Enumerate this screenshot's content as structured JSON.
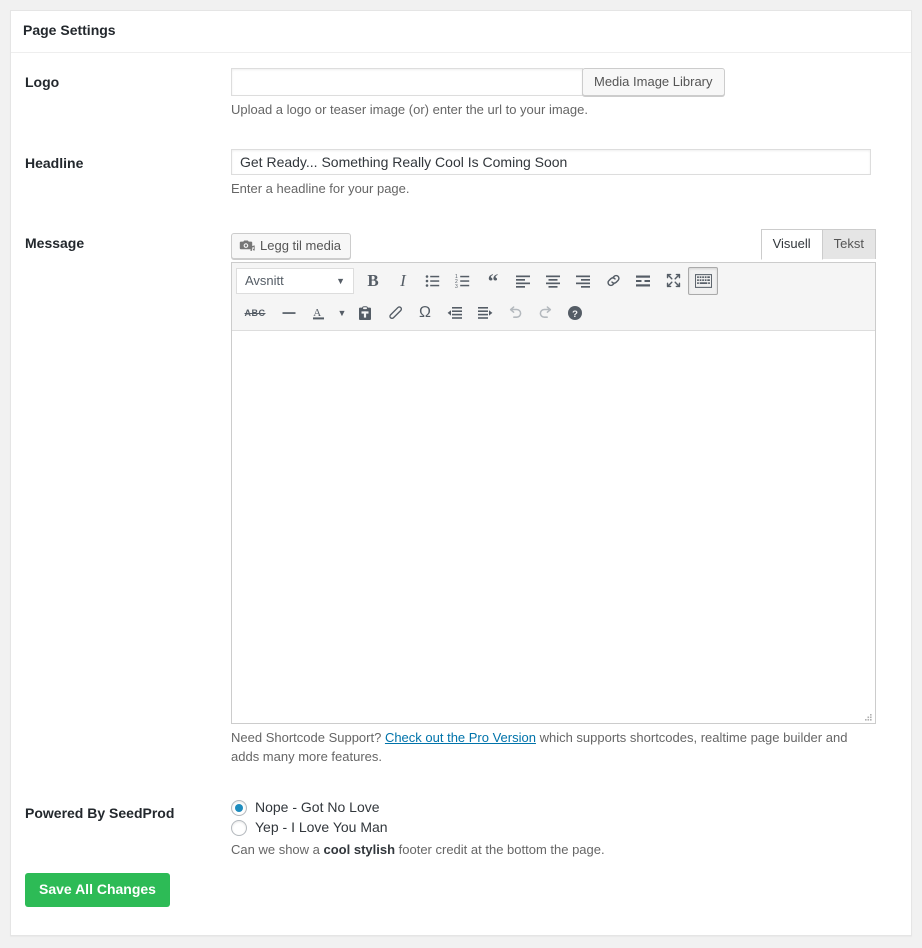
{
  "panel": {
    "title": "Page Settings"
  },
  "fields": {
    "logo": {
      "label": "Logo",
      "value": "",
      "placeholder": "",
      "button_label": "Media Image Library",
      "description": "Upload a logo or teaser image (or) enter the url to your image."
    },
    "headline": {
      "label": "Headline",
      "value": "Get Ready... Something Really Cool Is Coming Soon",
      "placeholder": "",
      "description": "Enter a headline for your page."
    },
    "message": {
      "label": "Message",
      "media_button_label": "Legg til media",
      "media_button_icon": "add-media-icon",
      "tabs": [
        {
          "label": "Visuell",
          "active": true
        },
        {
          "label": "Tekst",
          "active": false
        }
      ],
      "format_select": "Avsnitt",
      "toolbar_row_1": [
        {
          "name": "bold-icon",
          "glyph": "B",
          "style": "bold-serif",
          "active": false
        },
        {
          "name": "italic-icon",
          "glyph": "I",
          "style": "italic-serif",
          "active": false
        },
        {
          "name": "bulleted-list-icon",
          "glyph": "",
          "style": "svg-ul",
          "active": false
        },
        {
          "name": "numbered-list-icon",
          "glyph": "",
          "style": "svg-ol",
          "active": false
        },
        {
          "name": "blockquote-icon",
          "glyph": "“",
          "style": "quote",
          "active": false
        },
        {
          "name": "align-left-icon",
          "glyph": "",
          "style": "svg-alignleft",
          "active": false
        },
        {
          "name": "align-center-icon",
          "glyph": "",
          "style": "svg-aligncenter",
          "active": false
        },
        {
          "name": "align-right-icon",
          "glyph": "",
          "style": "svg-alignright",
          "active": false
        },
        {
          "name": "insert-link-icon",
          "glyph": "",
          "style": "svg-link",
          "active": false
        },
        {
          "name": "read-more-icon",
          "glyph": "",
          "style": "svg-more",
          "active": false
        },
        {
          "name": "fullscreen-icon",
          "glyph": "",
          "style": "svg-fullscreen",
          "active": false
        },
        {
          "name": "kitchen-sink-icon",
          "glyph": "",
          "style": "svg-sink",
          "active": true
        }
      ],
      "toolbar_row_2": [
        {
          "name": "strikethrough-icon",
          "glyph": "ABC",
          "style": "abc",
          "active": false
        },
        {
          "name": "horizontal-rule-icon",
          "glyph": "",
          "style": "svg-hr",
          "active": false
        },
        {
          "name": "text-color-icon",
          "glyph": "A",
          "style": "svg-textcolor",
          "active": false
        },
        {
          "name": "text-color-dropdown-icon",
          "glyph": "▼",
          "style": "caret-only",
          "active": false
        },
        {
          "name": "paste-as-text-icon",
          "glyph": "",
          "style": "svg-paste",
          "active": false
        },
        {
          "name": "clear-formatting-icon",
          "glyph": "",
          "style": "svg-eraser",
          "active": false
        },
        {
          "name": "special-character-icon",
          "glyph": "Ω",
          "style": "omega",
          "active": false
        },
        {
          "name": "decrease-indent-icon",
          "glyph": "",
          "style": "svg-outdent",
          "active": false
        },
        {
          "name": "increase-indent-icon",
          "glyph": "",
          "style": "svg-indent",
          "active": false
        },
        {
          "name": "undo-icon",
          "glyph": "",
          "style": "svg-undo",
          "active": false,
          "disabled": true
        },
        {
          "name": "redo-icon",
          "glyph": "",
          "style": "svg-redo",
          "active": false,
          "disabled": true
        },
        {
          "name": "help-icon",
          "glyph": "",
          "style": "svg-help",
          "active": false
        }
      ],
      "body_value": "",
      "shortcode_note_prefix": "Need Shortcode Support? ",
      "shortcode_link_text": "Check out the Pro Version",
      "shortcode_note_suffix": " which supports shortcodes, realtime page builder and adds many more features."
    },
    "powered_by": {
      "label": "Powered By SeedProd",
      "options": [
        {
          "label": "Nope - Got No Love",
          "checked": true
        },
        {
          "label": "Yep - I Love You Man",
          "checked": false
        }
      ],
      "description_prefix": "Can we show a ",
      "description_bold": "cool stylish",
      "description_suffix": " footer credit at the bottom the page."
    }
  },
  "actions": {
    "save_label": "Save All Changes"
  },
  "colors": {
    "accent_green": "#2dbb56",
    "link_blue": "#0073aa",
    "radio_blue": "#1e8cbe",
    "page_bg": "#f1f1f1",
    "card_bg": "#ffffff",
    "border": "#e5e5e5"
  }
}
